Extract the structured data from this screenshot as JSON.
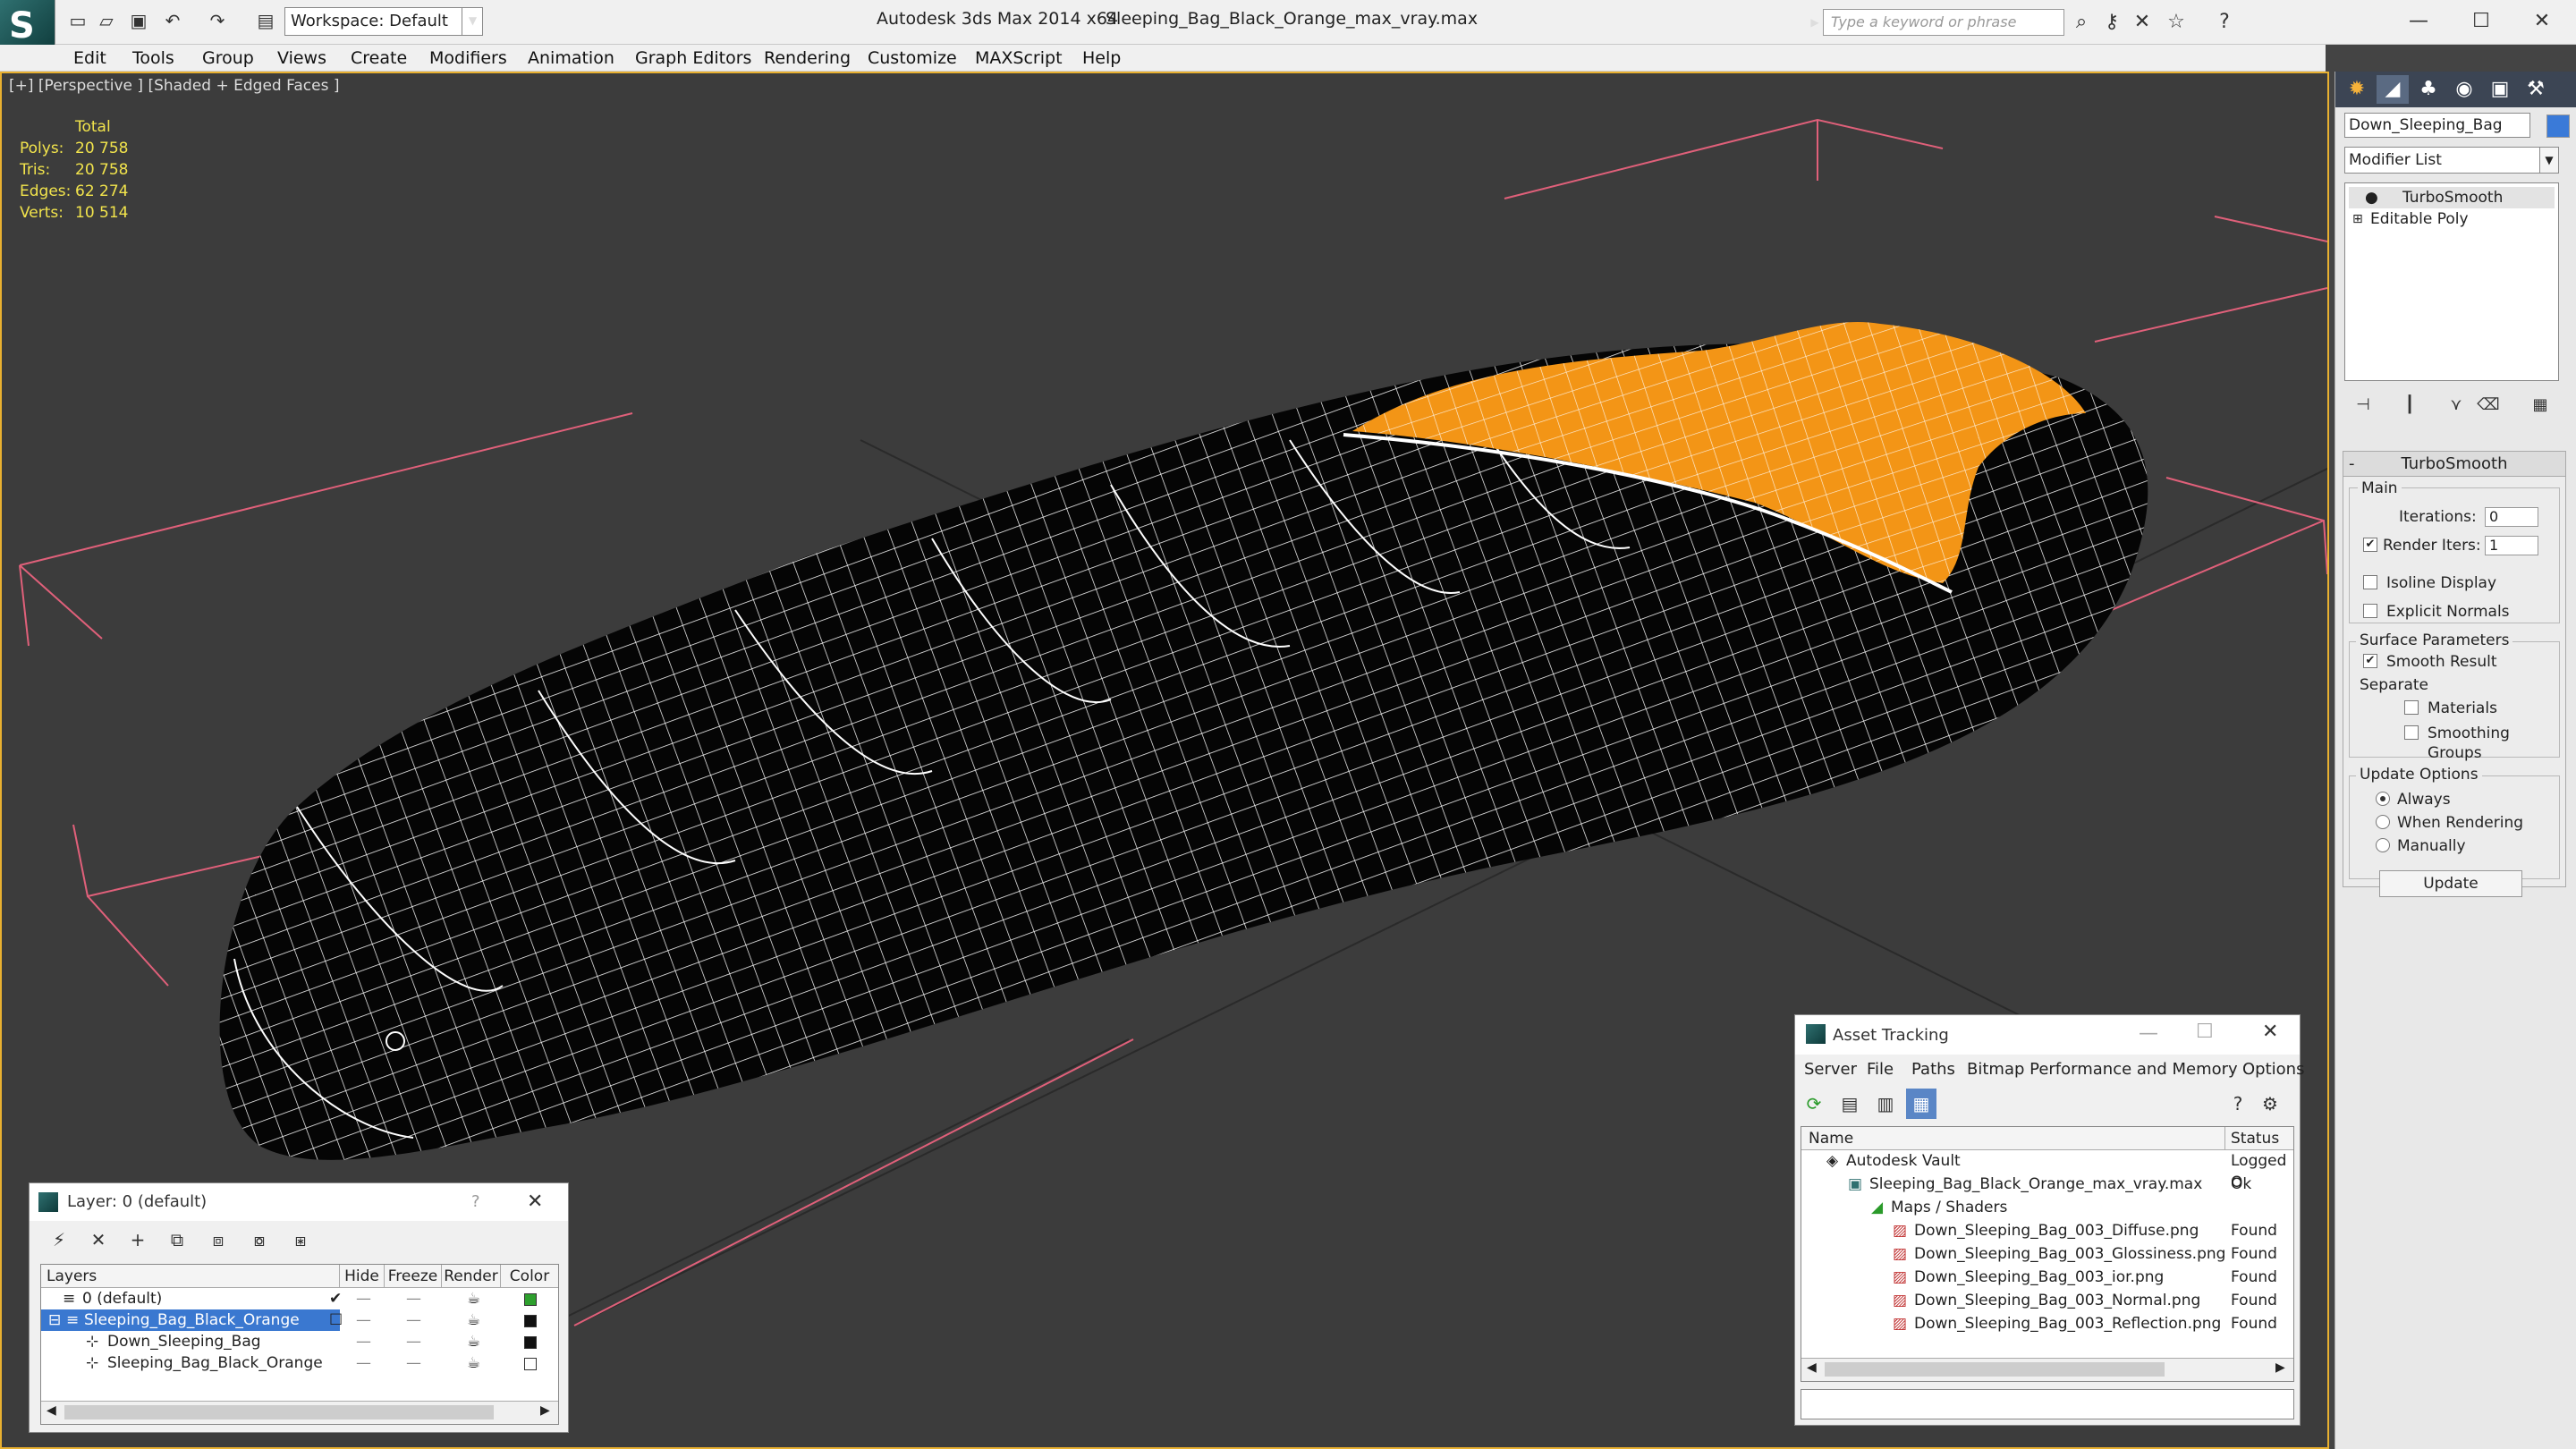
{
  "window": {
    "app_title": "Autodesk 3ds Max  2014 x64",
    "file_title": "Sleeping_Bag_Black_Orange_max_vray.max",
    "workspace": "Workspace: Default",
    "search_placeholder": "Type a keyword or phrase"
  },
  "menu": [
    "Edit",
    "Tools",
    "Group",
    "Views",
    "Create",
    "Modifiers",
    "Animation",
    "Graph Editors",
    "Rendering",
    "Customize",
    "MAXScript",
    "Help"
  ],
  "viewport": {
    "label": "[+] [Perspective ] [Shaded + Edged Faces ]",
    "stats": {
      "header": "Total",
      "rows": [
        {
          "k": "Polys:",
          "v": "20 758"
        },
        {
          "k": "Tris:",
          "v": "20 758"
        },
        {
          "k": "Edges:",
          "v": "62 274"
        },
        {
          "k": "Verts:",
          "v": "10 514"
        }
      ]
    }
  },
  "command_panel": {
    "object_name": "Down_Sleeping_Bag",
    "modifier_list": "Modifier List",
    "stack": [
      "TurboSmooth",
      "Editable Poly"
    ],
    "rollout": {
      "title": "TurboSmooth",
      "main": "Main",
      "iterations_label": "Iterations:",
      "iterations": "0",
      "render_iters_label": "Render Iters:",
      "render_iters": "1",
      "isoline": "Isoline Display",
      "explicit": "Explicit Normals",
      "surface": "Surface Parameters",
      "smooth_result": "Smooth Result",
      "separate": "Separate",
      "materials": "Materials",
      "smoothing_groups": "Smoothing Groups",
      "update_options": "Update Options",
      "always": "Always",
      "when_rendering": "When Rendering",
      "manually": "Manually",
      "update": "Update"
    }
  },
  "layer_panel": {
    "title": "Layer: 0 (default)",
    "help": "?",
    "columns": [
      "Layers",
      "Hide",
      "Freeze",
      "Render",
      "Color"
    ],
    "rows": [
      {
        "name": "0 (default)",
        "color": "#3a7ad8"
      },
      {
        "name": "Sleeping_Bag_Black_Orange",
        "color": "#2ea02e"
      },
      {
        "name": "Down_Sleeping_Bag",
        "color": "#111111"
      },
      {
        "name": "Sleeping_Bag_Black_Orange",
        "color": "#111111"
      }
    ]
  },
  "asset_panel": {
    "title": "Asset Tracking",
    "menu": [
      "Server",
      "File",
      "Paths",
      "Bitmap Performance and Memory",
      "Options"
    ],
    "columns": [
      "Name",
      "Status"
    ],
    "rows": [
      {
        "name": "Autodesk Vault",
        "status": "Logged O"
      },
      {
        "name": "Sleeping_Bag_Black_Orange_max_vray.max",
        "status": "Ok"
      },
      {
        "name": "Maps / Shaders",
        "status": ""
      },
      {
        "name": "Down_Sleeping_Bag_003_Diffuse.png",
        "status": "Found"
      },
      {
        "name": "Down_Sleeping_Bag_003_Glossiness.png",
        "status": "Found"
      },
      {
        "name": "Down_Sleeping_Bag_003_ior.png",
        "status": "Found"
      },
      {
        "name": "Down_Sleeping_Bag_003_Normal.png",
        "status": "Found"
      },
      {
        "name": "Down_Sleeping_Bag_003_Reflection.png",
        "status": "Found"
      }
    ]
  }
}
